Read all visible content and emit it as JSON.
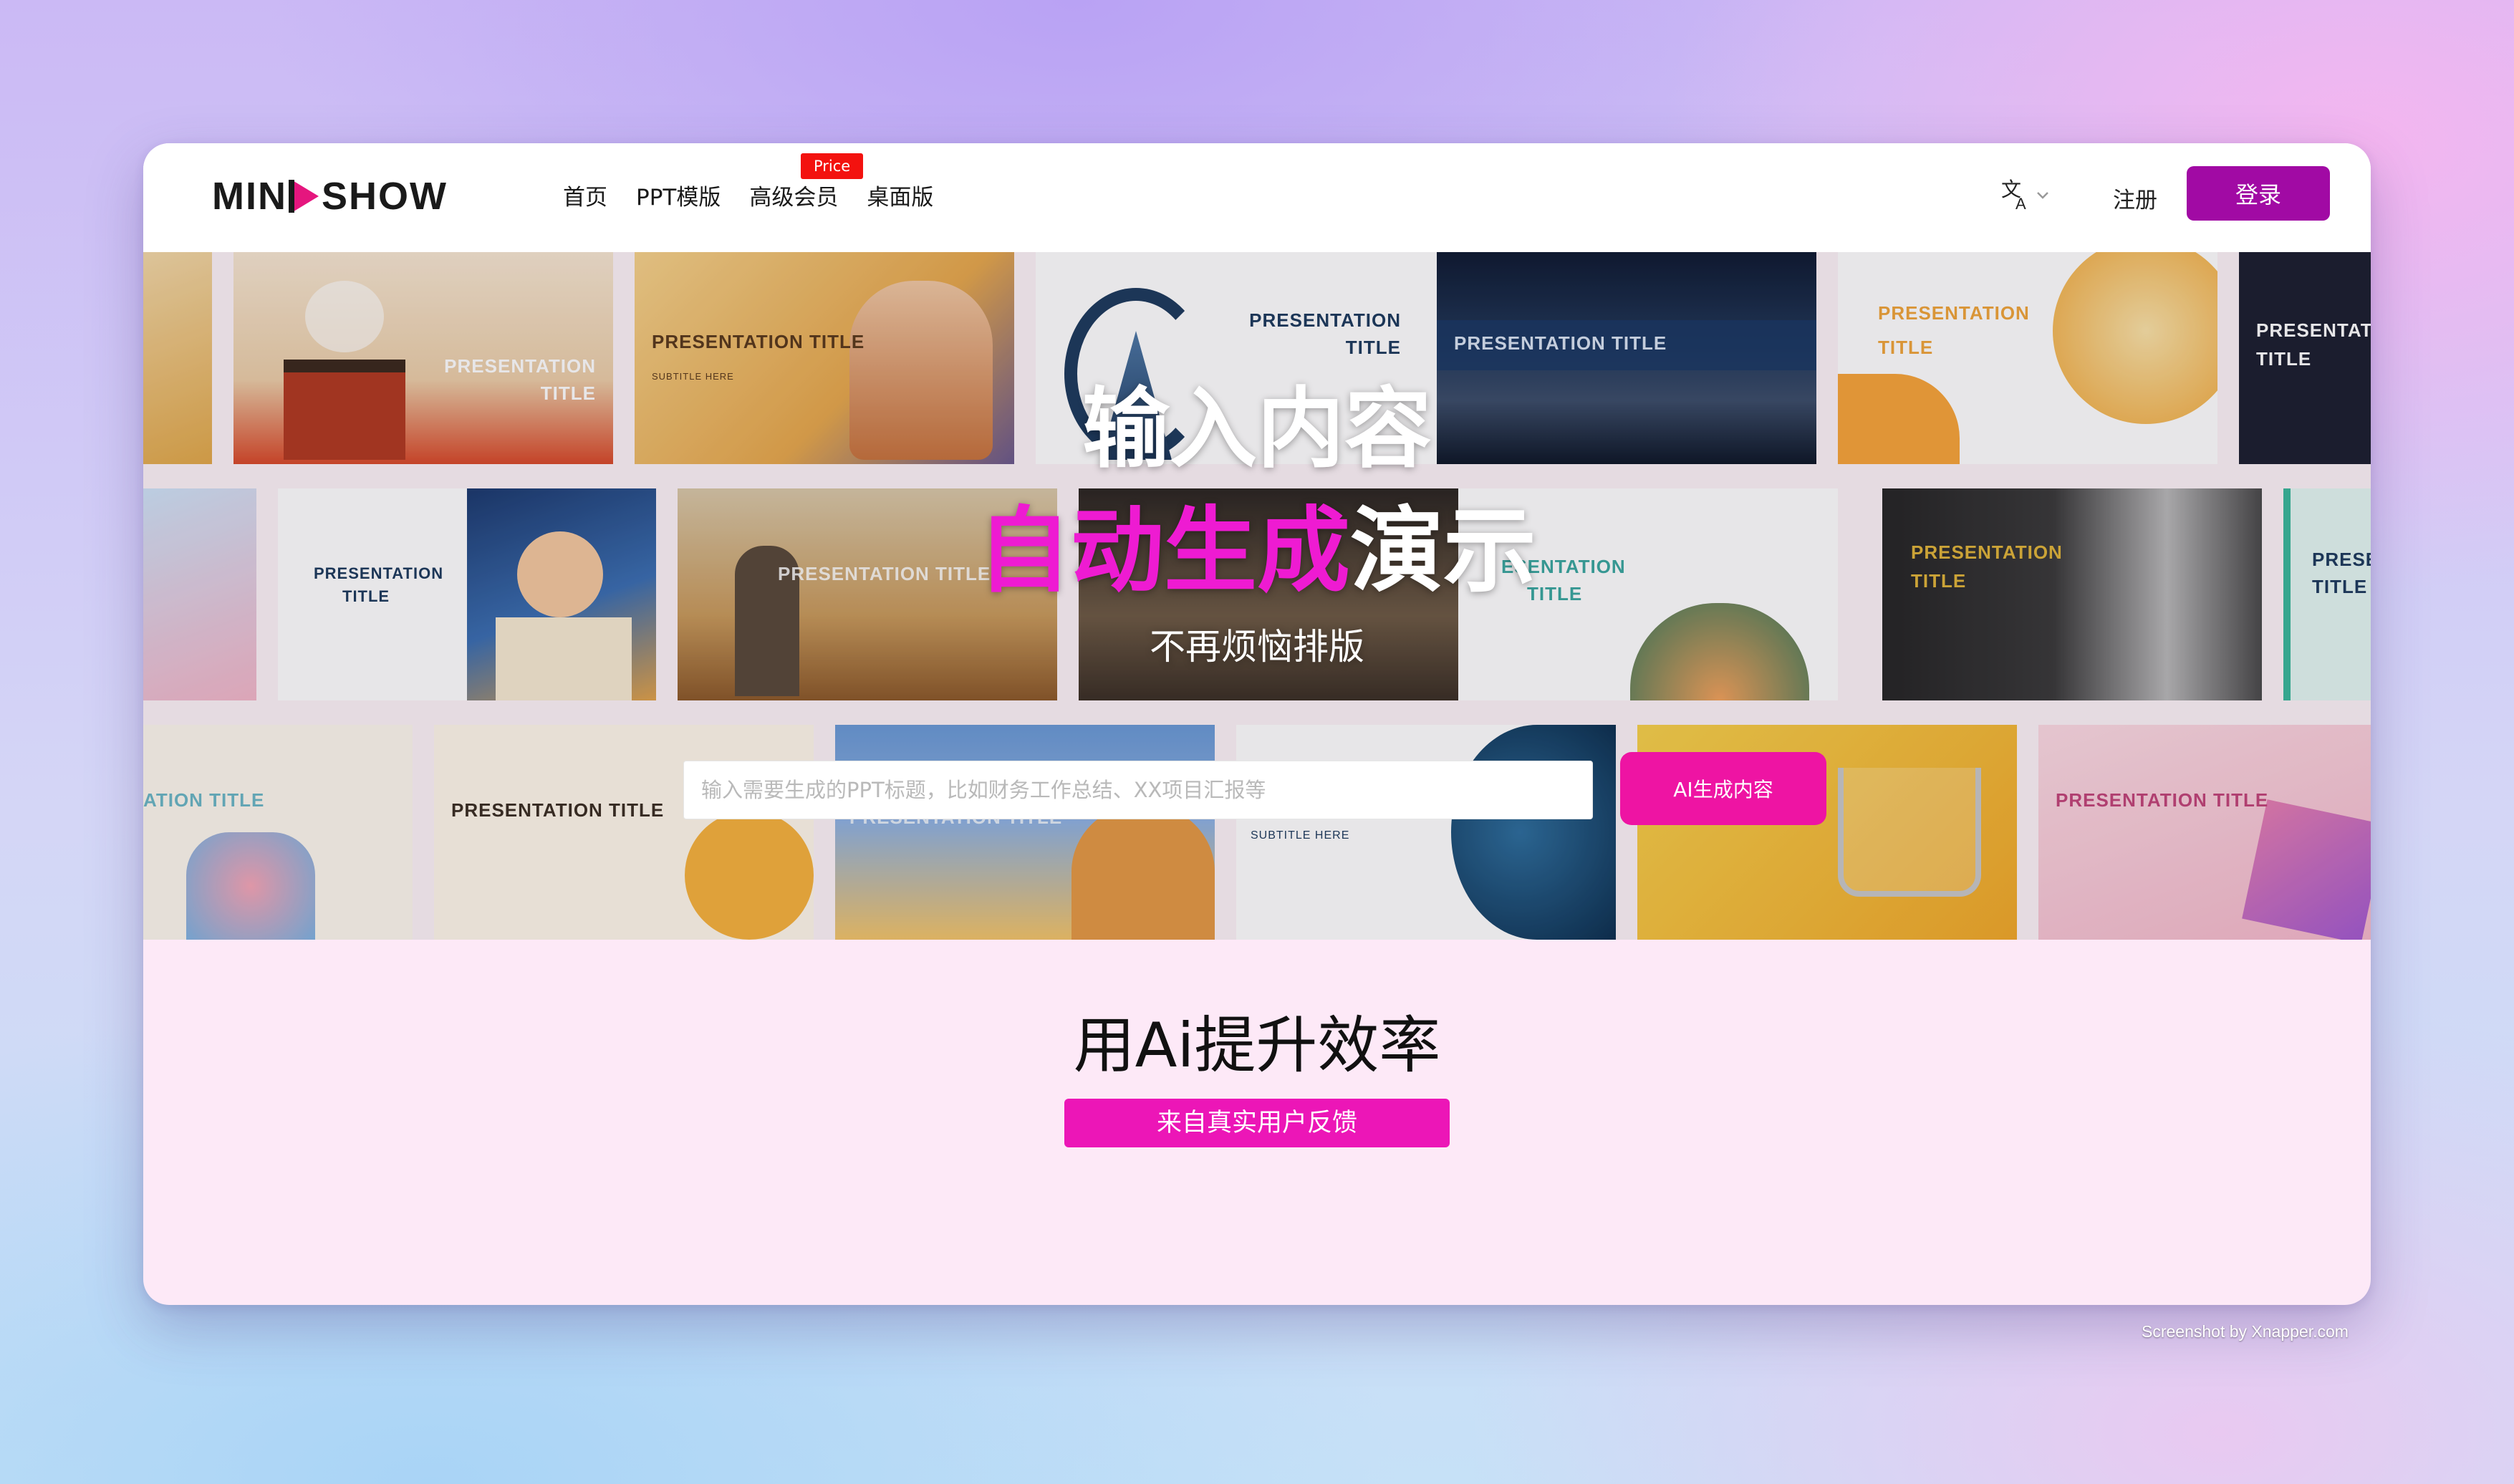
{
  "brand": {
    "logo_left": "MIN",
    "logo_right": "SHOW",
    "accent": "#a10aa4",
    "logo_play_color": "#e5167e"
  },
  "nav": {
    "items": [
      {
        "label": "首页"
      },
      {
        "label": "PPT模版"
      },
      {
        "label": "高级会员"
      },
      {
        "label": "桌面版"
      }
    ],
    "price_badge": "Price",
    "language_icon": "translate-icon",
    "register": "注册",
    "login": "登录"
  },
  "hero": {
    "line1": "输入内容",
    "line2_highlight": "自动生成",
    "line2_rest": "演示",
    "line3": "不再烦恼排版",
    "highlight_color": "#ee1bd2",
    "search": {
      "placeholder": "输入需要生成的PPT标题，比如财务工作总结、XX项目汇报等",
      "value": ""
    },
    "ai_button": "AI生成内容",
    "ai_button_color": "#ee14a3",
    "template_texts": {
      "presentation_title": "PRESENTATION TITLE",
      "presentation": "PRESENTATION",
      "title": "TITLE",
      "subtitle_here": "SUBTITLE HERE",
      "presentat": "PRESENTAT",
      "prese": "PRESE",
      "esentation": "ESENTATION",
      "ation_title": "ATION TITLE"
    }
  },
  "section": {
    "title": "用Ai提升效率",
    "feedback": "来自真实用户反馈"
  },
  "credit": "Screenshot by Xnapper.com"
}
